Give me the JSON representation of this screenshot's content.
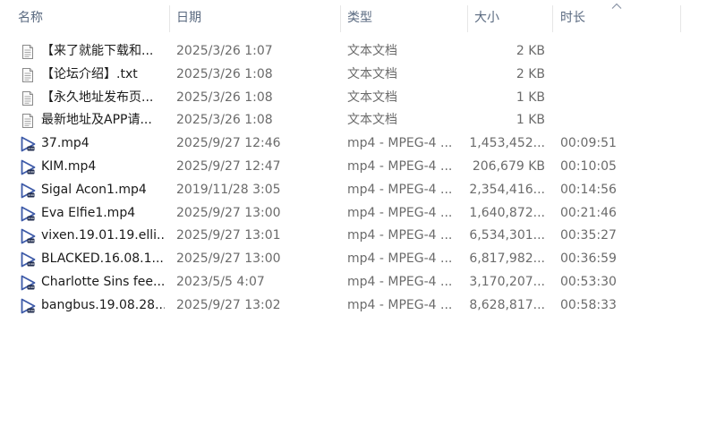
{
  "columns": {
    "name": "名称",
    "date": "日期",
    "type": "类型",
    "size": "大小",
    "duration": "时长"
  },
  "sort": {
    "column": "duration",
    "direction": "ascending",
    "icon": "chevron-up-icon"
  },
  "colors": {
    "header_text": "#5a6a80",
    "secondary_text": "#6b6b6b",
    "video_icon": "#3d5aa8"
  },
  "rows": [
    {
      "icon": "text-file-icon",
      "name": "【来了就能下载和...",
      "date": "2025/3/26 1:07",
      "type": "文本文档",
      "size": "2 KB",
      "duration": ""
    },
    {
      "icon": "text-file-icon",
      "name": "【论坛介绍】.txt",
      "date": "2025/3/26 1:08",
      "type": "文本文档",
      "size": "2 KB",
      "duration": ""
    },
    {
      "icon": "text-file-icon",
      "name": "【永久地址发布页...",
      "date": "2025/3/26 1:08",
      "type": "文本文档",
      "size": "1 KB",
      "duration": ""
    },
    {
      "icon": "text-file-icon",
      "name": "最新地址及APP请...",
      "date": "2025/3/26 1:08",
      "type": "文本文档",
      "size": "1 KB",
      "duration": ""
    },
    {
      "icon": "video-file-icon",
      "name": "37.mp4",
      "date": "2025/9/27 12:46",
      "type": "mp4 - MPEG-4 ...",
      "size": "1,453,452...",
      "duration": "00:09:51"
    },
    {
      "icon": "video-file-icon",
      "name": "KIM.mp4",
      "date": "2025/9/27 12:47",
      "type": "mp4 - MPEG-4 ...",
      "size": "206,679 KB",
      "duration": "00:10:05"
    },
    {
      "icon": "video-file-icon",
      "name": "Sigal Acon1.mp4",
      "date": "2019/11/28 3:05",
      "type": "mp4 - MPEG-4 ...",
      "size": "2,354,416...",
      "duration": "00:14:56"
    },
    {
      "icon": "video-file-icon",
      "name": "Eva Elfie1.mp4",
      "date": "2025/9/27 13:00",
      "type": "mp4 - MPEG-4 ...",
      "size": "1,640,872...",
      "duration": "00:21:46"
    },
    {
      "icon": "video-file-icon",
      "name": "vixen.19.01.19.elli...",
      "date": "2025/9/27 13:01",
      "type": "mp4 - MPEG-4 ...",
      "size": "6,534,301...",
      "duration": "00:35:27"
    },
    {
      "icon": "video-file-icon",
      "name": "BLACKED.16.08.1...",
      "date": "2025/9/27 13:00",
      "type": "mp4 - MPEG-4 ...",
      "size": "6,817,982...",
      "duration": "00:36:59"
    },
    {
      "icon": "video-file-icon",
      "name": "Charlotte Sins fee...",
      "date": "2023/5/5 4:07",
      "type": "mp4 - MPEG-4 ...",
      "size": "3,170,207...",
      "duration": "00:53:30"
    },
    {
      "icon": "video-file-icon",
      "name": "bangbus.19.08.28...",
      "date": "2025/9/27 13:02",
      "type": "mp4 - MPEG-4 ...",
      "size": "8,628,817...",
      "duration": "00:58:33"
    }
  ]
}
